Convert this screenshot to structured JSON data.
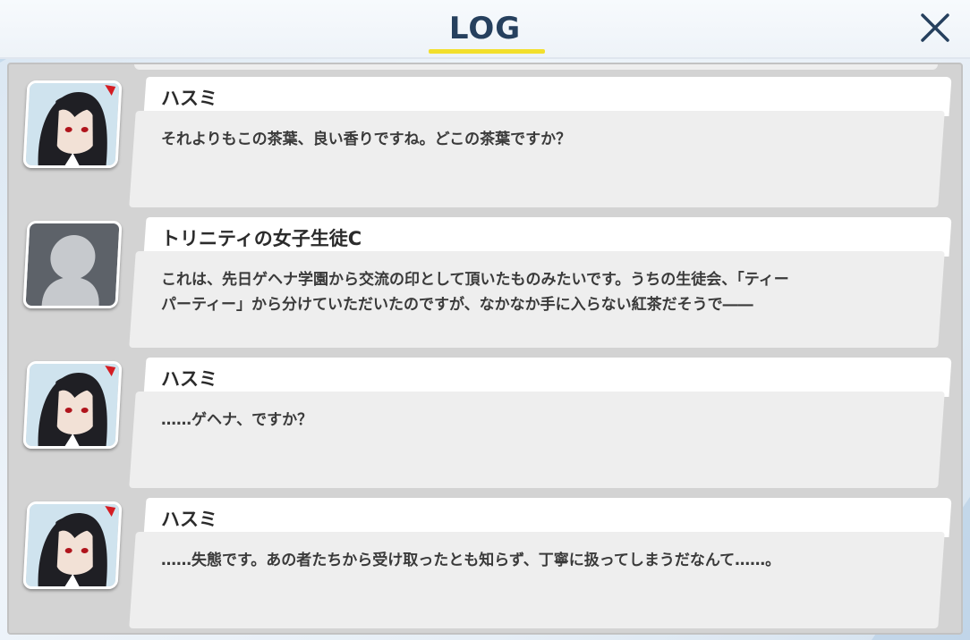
{
  "header": {
    "title": "LOG",
    "accent_color": "#f2df2c",
    "close_icon": "close-icon"
  },
  "entries": [
    {
      "speaker": "ハスミ",
      "avatar": "hasumi-portrait",
      "lines": [
        "それよりもこの茶葉、良い香りですね。どこの茶葉ですか？"
      ]
    },
    {
      "speaker": "トリニティの女子生徒C",
      "avatar": "generic-silhouette",
      "lines": [
        "これは、先日ゲヘナ学園から交流の印として頂いたものみたいです。うちの生徒会、「ティー",
        "パーティー」から分けていただいたのですが、なかなか手に入らない紅茶だそうで――"
      ]
    },
    {
      "speaker": "ハスミ",
      "avatar": "hasumi-portrait",
      "lines": [
        "……ゲヘナ、ですか？"
      ]
    },
    {
      "speaker": "ハスミ",
      "avatar": "hasumi-portrait",
      "lines": [
        "……失態です。あの者たちから受け取ったとも知らず、丁寧に扱ってしまうだなんて……。"
      ]
    }
  ]
}
